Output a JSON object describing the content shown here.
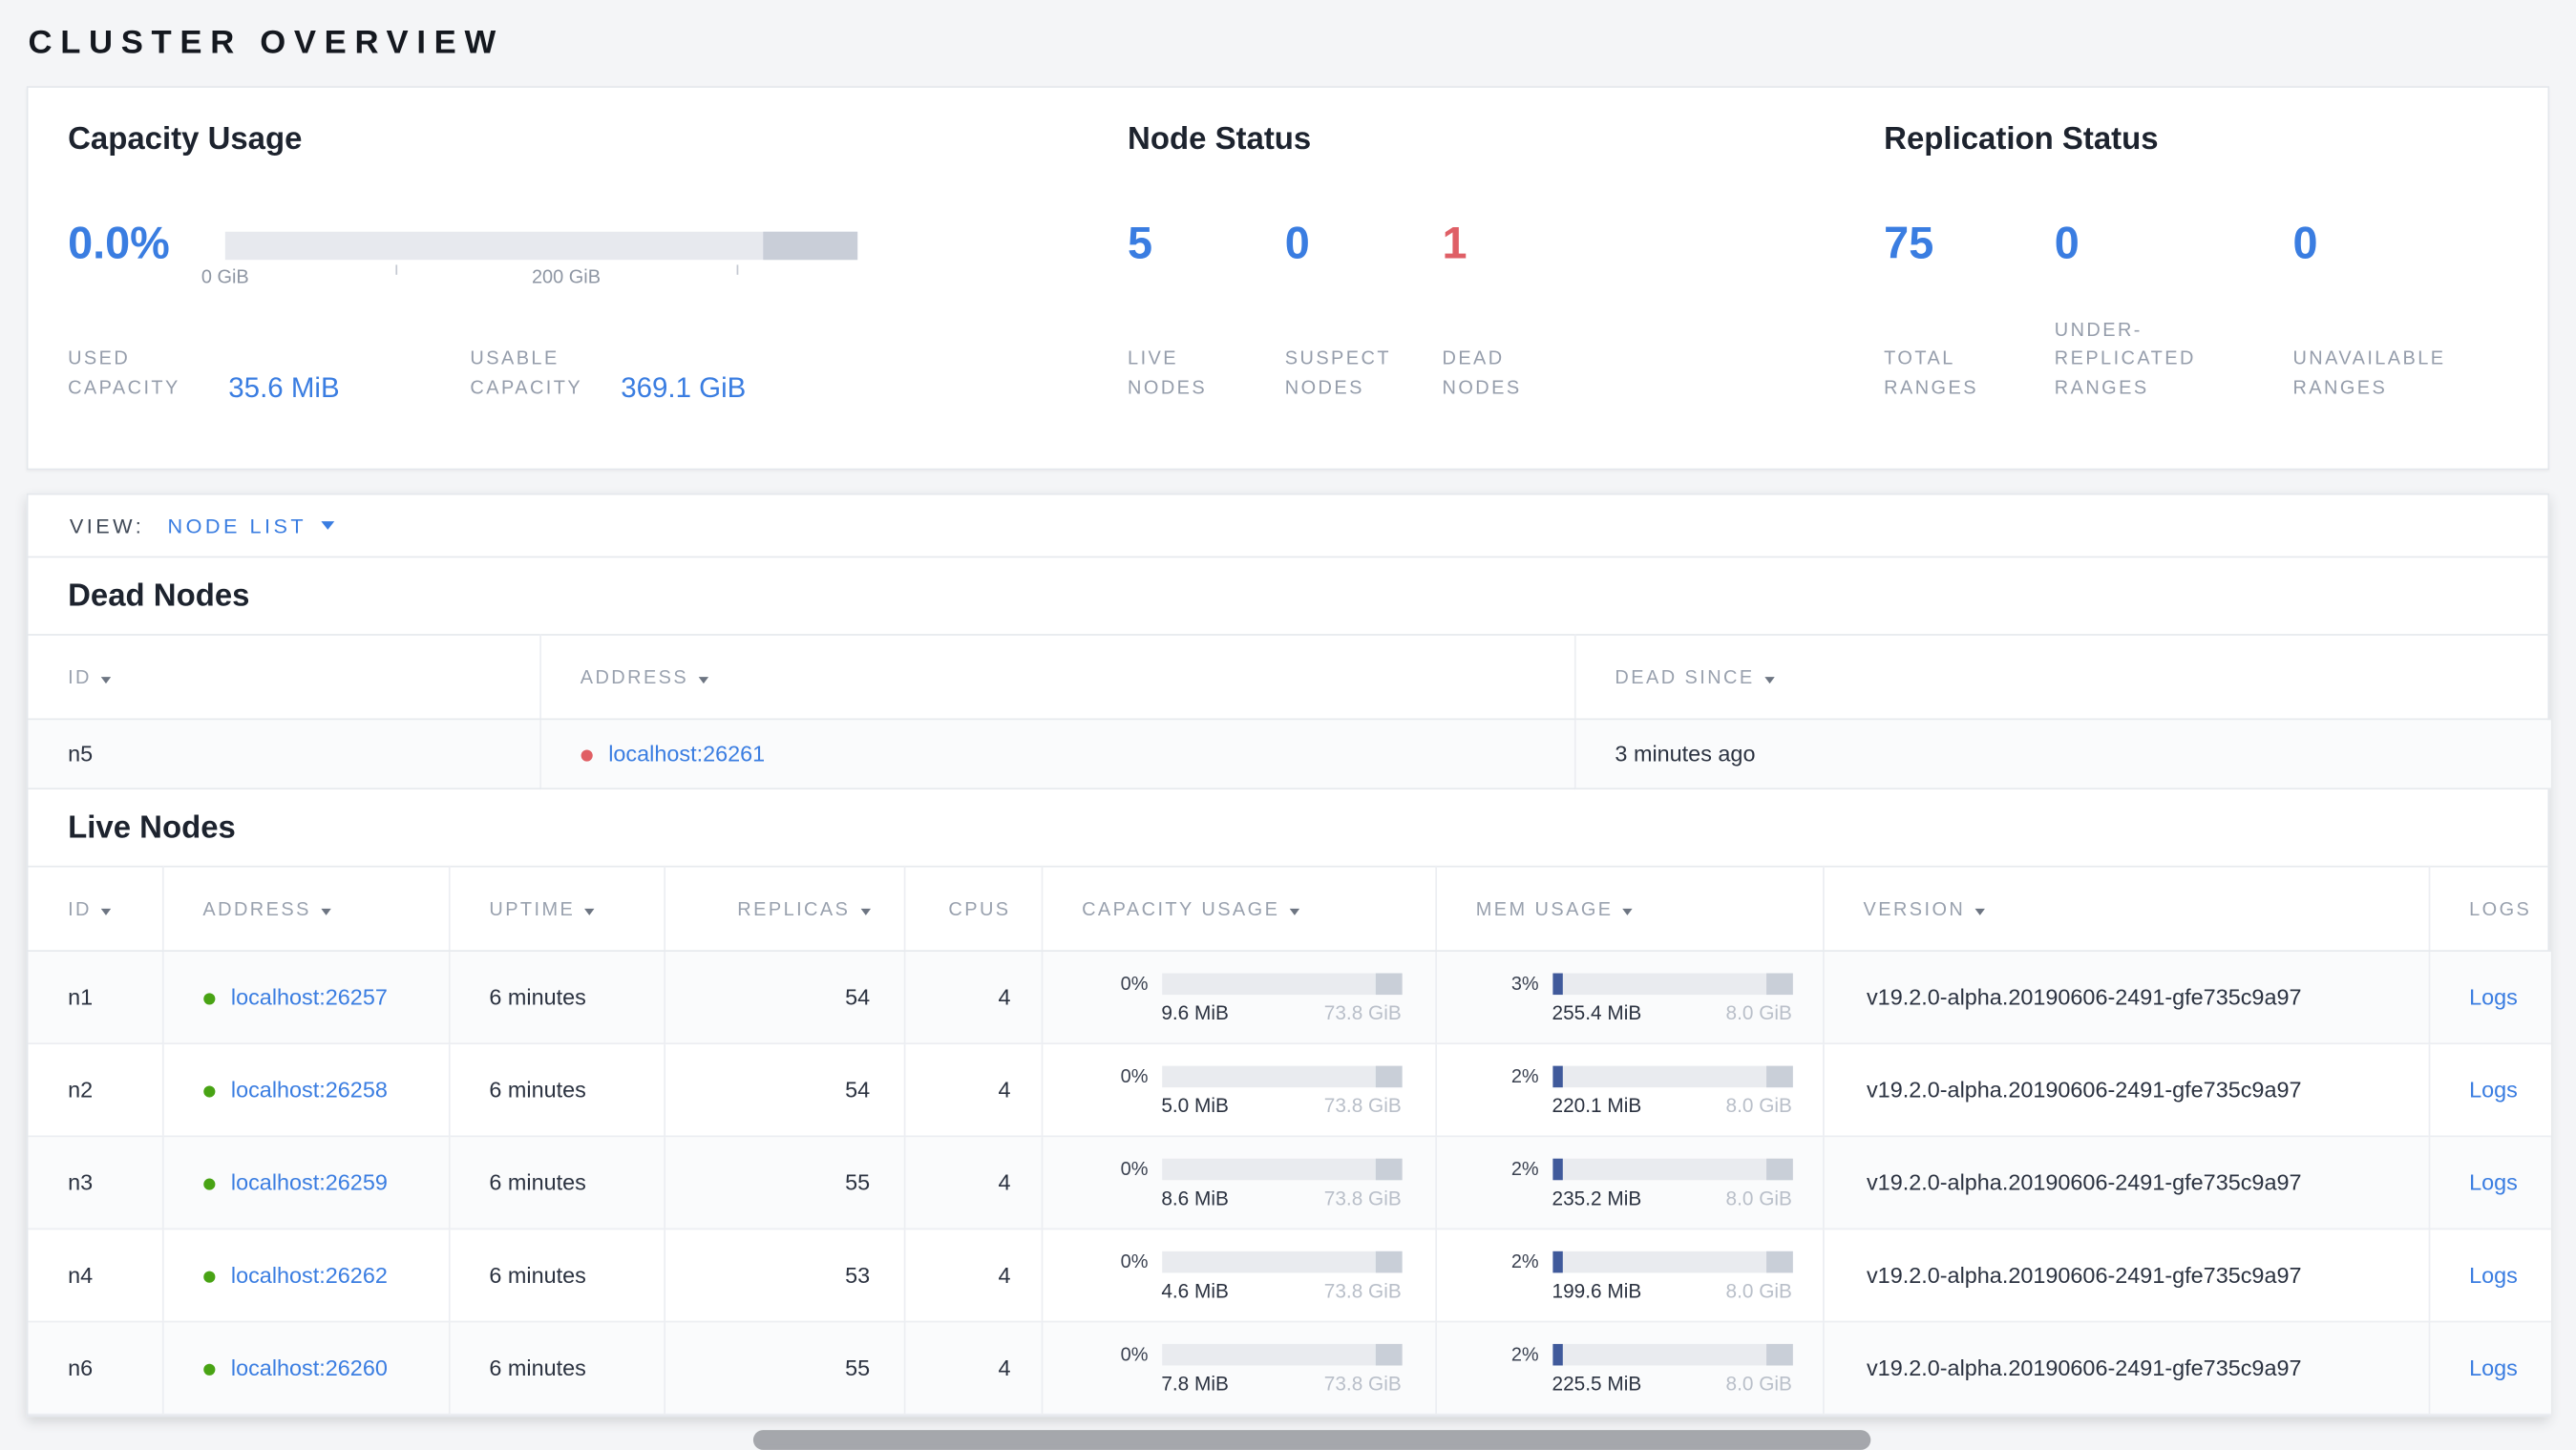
{
  "colors": {
    "accent_blue": "#3a7de1",
    "status_red": "#df5f66",
    "live_green": "#48a314",
    "background": "#f4f5f7"
  },
  "page": {
    "title": "CLUSTER OVERVIEW"
  },
  "summary": {
    "capacity": {
      "title": "Capacity Usage",
      "percent": "0.0%",
      "axis_tick_0": "0 GiB",
      "axis_tick_200": "200 GiB",
      "used_label": "USED CAPACITY",
      "used_value": "35.6 MiB",
      "usable_label": "USABLE CAPACITY",
      "usable_value": "369.1 GiB"
    },
    "node_status": {
      "title": "Node Status",
      "live": {
        "value": "5",
        "label": "LIVE NODES"
      },
      "suspect": {
        "value": "0",
        "label": "SUSPECT NODES"
      },
      "dead": {
        "value": "1",
        "label": "DEAD NODES"
      }
    },
    "replication": {
      "title": "Replication Status",
      "total": {
        "value": "75",
        "label": "TOTAL RANGES"
      },
      "under_replicated": {
        "value": "0",
        "label": "UNDER-REPLICATED RANGES"
      },
      "unavailable": {
        "value": "0",
        "label": "UNAVAILABLE RANGES"
      }
    }
  },
  "view_bar": {
    "label": "VIEW:",
    "selected": "NODE LIST"
  },
  "dead_nodes": {
    "title": "Dead Nodes",
    "columns": {
      "id": "ID",
      "address": "ADDRESS",
      "dead_since": "DEAD SINCE"
    },
    "rows": [
      {
        "id": "n5",
        "address": "localhost:26261",
        "dead_since": "3 minutes ago"
      }
    ]
  },
  "live_nodes": {
    "title": "Live Nodes",
    "columns": {
      "id": "ID",
      "address": "ADDRESS",
      "uptime": "UPTIME",
      "replicas": "REPLICAS",
      "cpus": "CPUS",
      "capacity": "CAPACITY USAGE",
      "mem": "MEM USAGE",
      "version": "VERSION",
      "logs": "LOGS"
    },
    "rows": [
      {
        "id": "n1",
        "address": "localhost:26257",
        "uptime": "6 minutes",
        "replicas": "54",
        "cpus": "4",
        "capacity_pct": "0%",
        "capacity_used": "9.6 MiB",
        "capacity_total": "73.8 GiB",
        "mem_pct": "3%",
        "mem_used": "255.4 MiB",
        "mem_total": "8.0 GiB",
        "version": "v19.2.0-alpha.20190606-2491-gfe735c9a97",
        "logs": "Logs"
      },
      {
        "id": "n2",
        "address": "localhost:26258",
        "uptime": "6 minutes",
        "replicas": "54",
        "cpus": "4",
        "capacity_pct": "0%",
        "capacity_used": "5.0 MiB",
        "capacity_total": "73.8 GiB",
        "mem_pct": "2%",
        "mem_used": "220.1 MiB",
        "mem_total": "8.0 GiB",
        "version": "v19.2.0-alpha.20190606-2491-gfe735c9a97",
        "logs": "Logs"
      },
      {
        "id": "n3",
        "address": "localhost:26259",
        "uptime": "6 minutes",
        "replicas": "55",
        "cpus": "4",
        "capacity_pct": "0%",
        "capacity_used": "8.6 MiB",
        "capacity_total": "73.8 GiB",
        "mem_pct": "2%",
        "mem_used": "235.2 MiB",
        "mem_total": "8.0 GiB",
        "version": "v19.2.0-alpha.20190606-2491-gfe735c9a97",
        "logs": "Logs"
      },
      {
        "id": "n4",
        "address": "localhost:26262",
        "uptime": "6 minutes",
        "replicas": "53",
        "cpus": "4",
        "capacity_pct": "0%",
        "capacity_used": "4.6 MiB",
        "capacity_total": "73.8 GiB",
        "mem_pct": "2%",
        "mem_used": "199.6 MiB",
        "mem_total": "8.0 GiB",
        "version": "v19.2.0-alpha.20190606-2491-gfe735c9a97",
        "logs": "Logs"
      },
      {
        "id": "n6",
        "address": "localhost:26260",
        "uptime": "6 minutes",
        "replicas": "55",
        "cpus": "4",
        "capacity_pct": "0%",
        "capacity_used": "7.8 MiB",
        "capacity_total": "73.8 GiB",
        "mem_pct": "2%",
        "mem_used": "225.5 MiB",
        "mem_total": "8.0 GiB",
        "version": "v19.2.0-alpha.20190606-2491-gfe735c9a97",
        "logs": "Logs"
      }
    ]
  }
}
